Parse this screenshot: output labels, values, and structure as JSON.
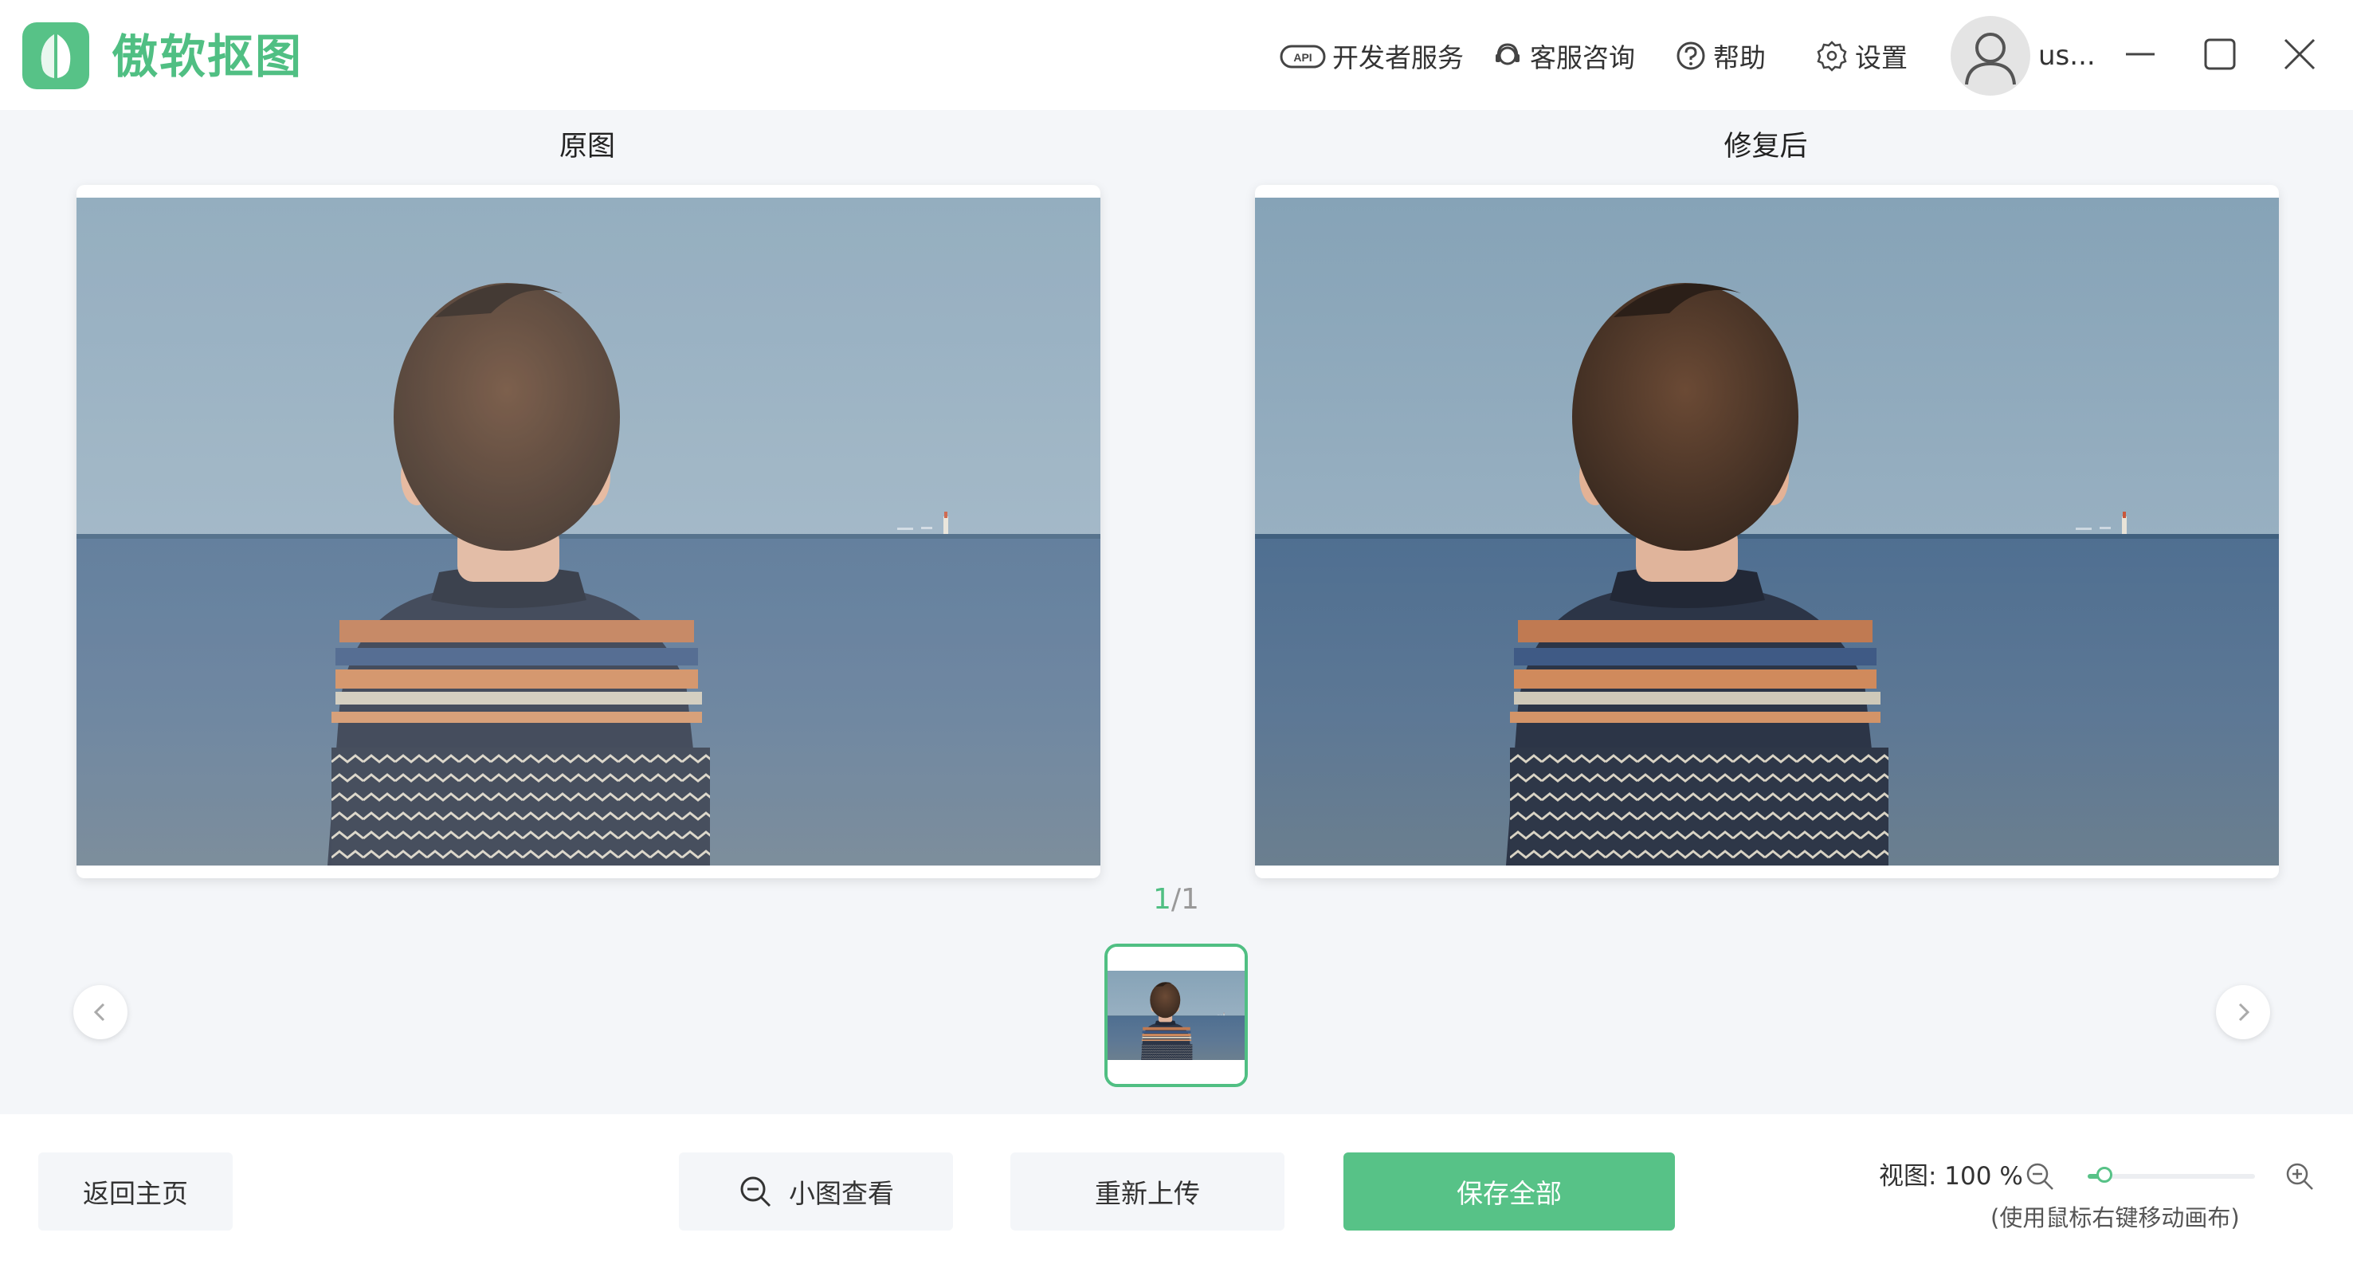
{
  "app": {
    "name": "傲软抠图"
  },
  "topbar": {
    "api_label": "开发者服务",
    "support_label": "客服咨询",
    "help_label": "帮助",
    "settings_label": "设置",
    "user_name": "us..."
  },
  "workspace": {
    "original_label": "原图",
    "repaired_label": "修复后",
    "page_current": "1",
    "page_total": "/1"
  },
  "footer": {
    "back_home_label": "返回主页",
    "small_view_label": "小图查看",
    "reupload_label": "重新上传",
    "save_all_label": "保存全部",
    "zoom_label": "视图: 100 %",
    "zoom_percent": 100,
    "zoom_slider_value": 0.1,
    "zoom_hint": "(使用鼠标右键移动画布)"
  },
  "colors": {
    "accent": "#57c287",
    "background": "#f4f6f9"
  },
  "icons": {
    "api": "api-cloud-icon",
    "support": "headset-icon",
    "help": "question-circle-icon",
    "settings": "gear-icon",
    "avatar": "user-avatar-icon",
    "minimize": "minimize-icon",
    "maximize": "maximize-icon",
    "close": "close-icon",
    "prev": "chevron-left-icon",
    "next": "chevron-right-icon",
    "small_view": "zoom-out-icon",
    "zoom_out": "zoom-out-icon",
    "zoom_in": "zoom-in-icon"
  }
}
